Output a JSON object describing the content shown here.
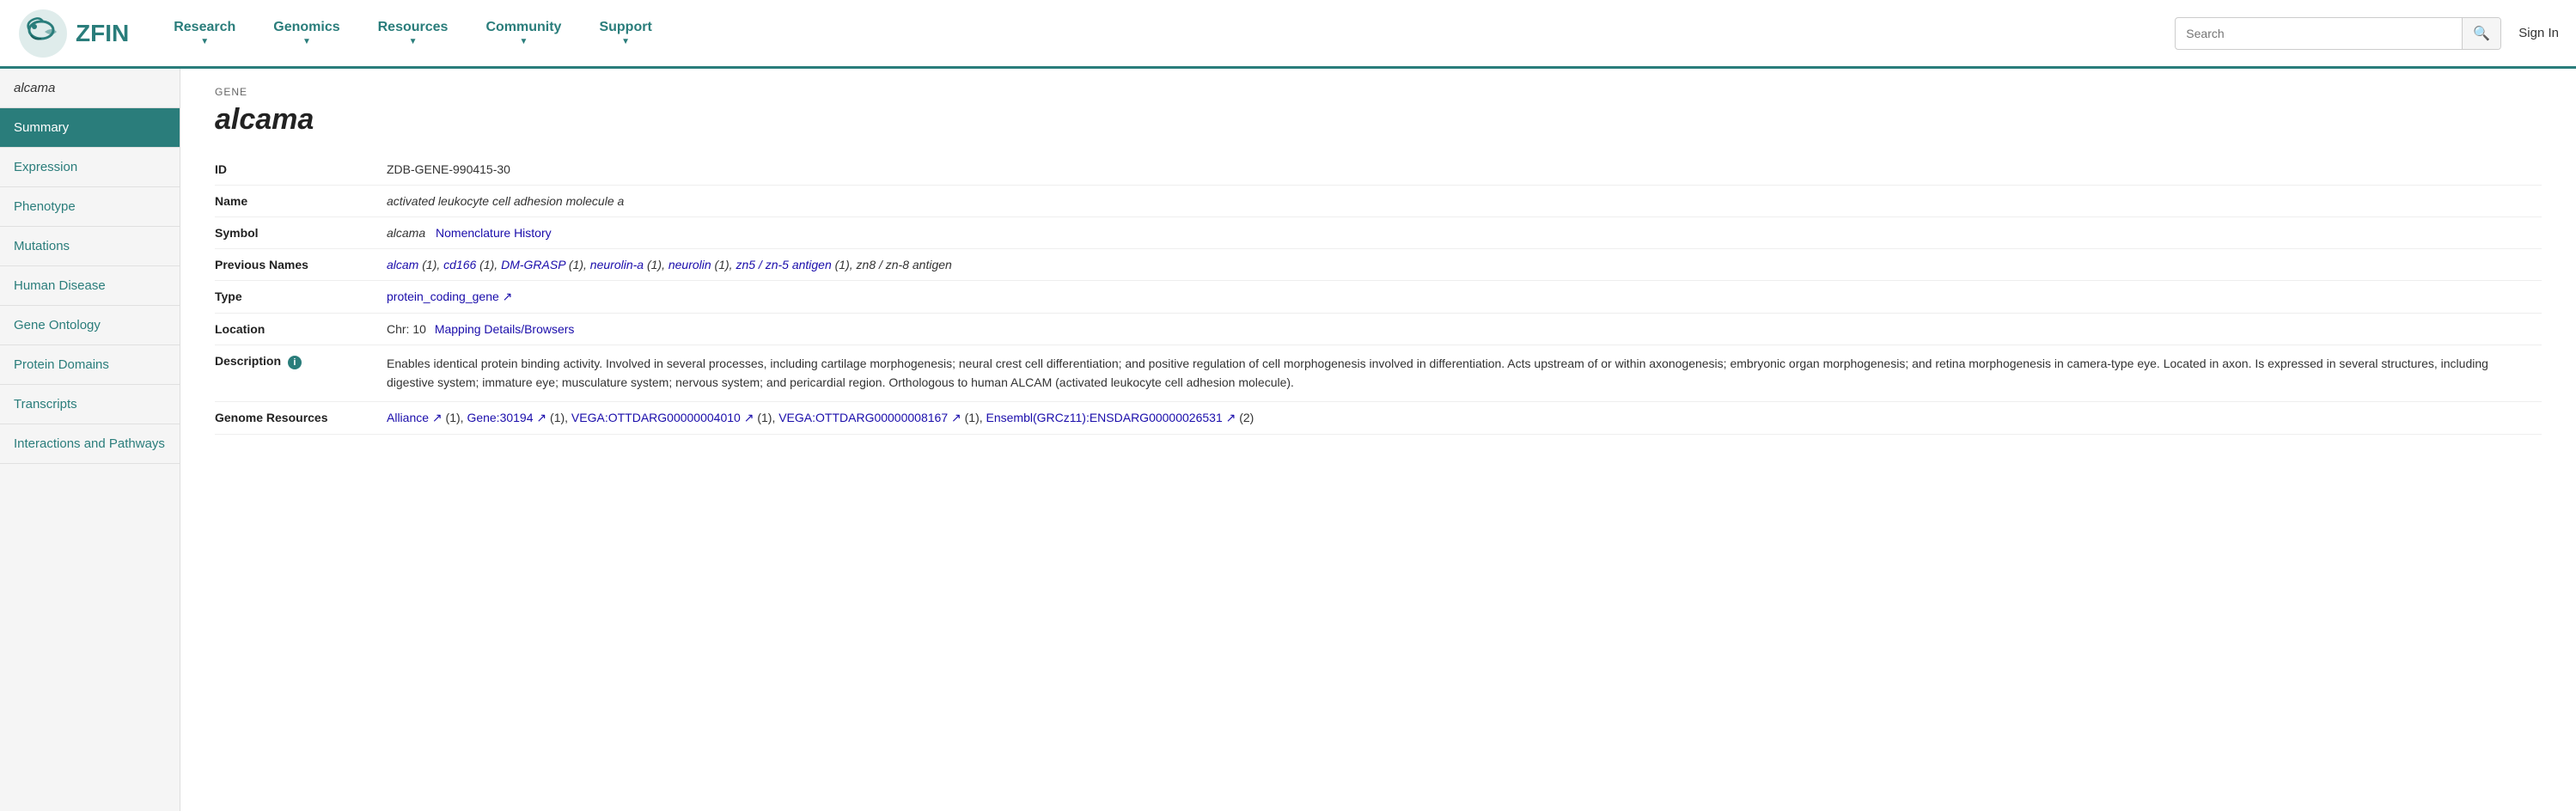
{
  "header": {
    "logo_text": "ZFIN",
    "nav_items": [
      {
        "label": "Research",
        "id": "research"
      },
      {
        "label": "Genomics",
        "id": "genomics"
      },
      {
        "label": "Resources",
        "id": "resources"
      },
      {
        "label": "Community",
        "id": "community"
      },
      {
        "label": "Support",
        "id": "support"
      }
    ],
    "search_placeholder": "Search",
    "signin_label": "Sign In"
  },
  "sidebar": {
    "gene_title": "alcama",
    "items": [
      {
        "label": "Summary",
        "id": "summary",
        "active": true
      },
      {
        "label": "Expression",
        "id": "expression"
      },
      {
        "label": "Phenotype",
        "id": "phenotype"
      },
      {
        "label": "Mutations",
        "id": "mutations"
      },
      {
        "label": "Human Disease",
        "id": "human-disease"
      },
      {
        "label": "Gene Ontology",
        "id": "gene-ontology"
      },
      {
        "label": "Protein Domains",
        "id": "protein-domains"
      },
      {
        "label": "Transcripts",
        "id": "transcripts"
      },
      {
        "label": "Interactions and Pathways",
        "id": "interactions-and-pathways"
      }
    ]
  },
  "main": {
    "gene_label": "GENE",
    "gene_title": "alcama",
    "fields": {
      "id_label": "ID",
      "id_value": "ZDB-GENE-990415-30",
      "name_label": "Name",
      "name_value": "activated leukocyte cell adhesion molecule a",
      "symbol_label": "Symbol",
      "symbol_value": "alcama",
      "nomenclature_label": "Nomenclature History",
      "previous_names_label": "Previous Names",
      "previous_names_value": "alcam (1), cd166 (1), DM-GRASP (1), neurolin-a (1), neurolin (1), zn5 / zn-5 antigen (1), zn8 / zn-8 antigen",
      "type_label": "Type",
      "type_value": "protein_coding_gene",
      "location_label": "Location",
      "location_chr": "Chr: 10",
      "location_link": "Mapping Details/Browsers",
      "description_label": "Description",
      "description_text": "Enables identical protein binding activity. Involved in several processes, including cartilage morphogenesis; neural crest cell differentiation; and positive regulation of cell morphogenesis involved in differentiation. Acts upstream of or within axonogenesis; embryonic organ morphogenesis; and retina morphogenesis in camera-type eye. Located in axon. Is expressed in several structures, including digestive system; immature eye; musculature system; nervous system; and pericardial region. Orthologous to human ALCAM (activated leukocyte cell adhesion molecule).",
      "genome_resources_label": "Genome Resources",
      "genome_resources": [
        {
          "label": "Alliance",
          "suffix": "(1)"
        },
        {
          "label": "Gene:30194",
          "suffix": "(1)"
        },
        {
          "label": "VEGA:OTTDARG00000004010",
          "suffix": "(1)"
        },
        {
          "label": "VEGA:OTTDARG00000008167",
          "suffix": "(1)"
        },
        {
          "label": "Ensembl(GRCz11):ENSDARG00000026531",
          "suffix": "(2)"
        }
      ]
    }
  }
}
